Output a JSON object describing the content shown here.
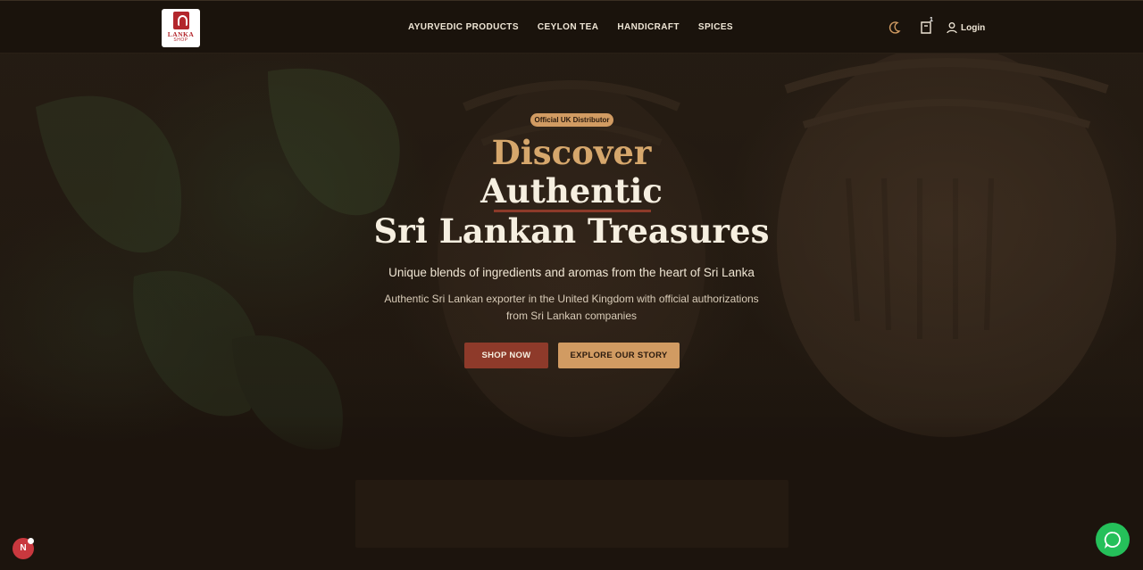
{
  "brand": {
    "logo_text": "LANKA",
    "logo_sub": "SHOP"
  },
  "nav": {
    "items": [
      {
        "label": "AYURVEDIC PRODUCTS"
      },
      {
        "label": "CEYLON TEA"
      },
      {
        "label": "HANDICRAFT"
      },
      {
        "label": "SPICES"
      }
    ]
  },
  "header": {
    "theme_icon": "moon-icon",
    "cart_icon": "cart-icon",
    "cart_count": "1",
    "login_label": "Login",
    "user_icon": "user-icon"
  },
  "hero": {
    "badge": "Official UK Distributor",
    "title_line1": "Discover",
    "title_line2": "Authentic",
    "title_line3": "Sri Lankan Treasures",
    "subtitle": "Unique blends of ingredients and aromas from the heart of Sri Lanka",
    "description": "Authentic Sri Lankan exporter in the United Kingdom with official authorizations from Sri Lankan companies",
    "primary_button": "SHOP NOW",
    "secondary_button": "EXPLORE OUR STORY"
  },
  "floating": {
    "notification_letter": "N",
    "chat_icon": "whatsapp-icon"
  },
  "colors": {
    "accent_gold": "#d19b62",
    "accent_rust": "#8e3a2a",
    "whatsapp_green": "#25c05a",
    "background": "#1c140d"
  }
}
